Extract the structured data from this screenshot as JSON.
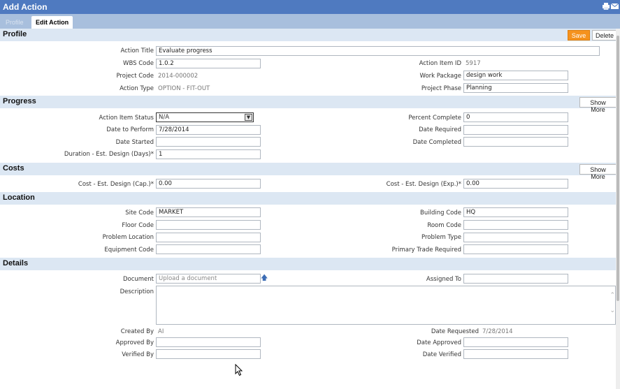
{
  "window": {
    "title": "Add Action"
  },
  "tabs": [
    {
      "label": "Profile"
    },
    {
      "label": "Edit Action"
    }
  ],
  "sections": {
    "profile": {
      "title": "Profile",
      "save": "Save",
      "delete": "Delete"
    },
    "progress": {
      "title": "Progress",
      "show_more": "Show More"
    },
    "costs": {
      "title": "Costs",
      "show_more": "Show More"
    },
    "location": {
      "title": "Location"
    },
    "details": {
      "title": "Details"
    }
  },
  "profile": {
    "action_title": {
      "label": "Action Title",
      "value": "Evaluate progress"
    },
    "wbs_code": {
      "label": "WBS Code",
      "value": "1.0.2"
    },
    "action_item_id": {
      "label": "Action Item ID",
      "value": "5917"
    },
    "project_code": {
      "label": "Project Code",
      "value": "2014-000002"
    },
    "work_package": {
      "label": "Work Package",
      "value": "design work"
    },
    "action_type": {
      "label": "Action Type",
      "value": "OPTION - FIT-OUT"
    },
    "project_phase": {
      "label": "Project Phase",
      "value": "Planning"
    }
  },
  "progress": {
    "status": {
      "label": "Action Item Status",
      "value": "N/A"
    },
    "percent_complete": {
      "label": "Percent Complete",
      "value": "0"
    },
    "date_to_perform": {
      "label": "Date to Perform",
      "value": "7/28/2014"
    },
    "date_required": {
      "label": "Date Required",
      "value": ""
    },
    "date_started": {
      "label": "Date Started",
      "value": ""
    },
    "date_completed": {
      "label": "Date Completed",
      "value": ""
    },
    "duration": {
      "label": "Duration - Est. Design (Days)*",
      "value": "1"
    }
  },
  "costs": {
    "cap": {
      "label": "Cost - Est. Design (Cap.)*",
      "value": "0.00"
    },
    "exp": {
      "label": "Cost - Est. Design (Exp.)*",
      "value": "0.00"
    }
  },
  "location": {
    "site_code": {
      "label": "Site Code",
      "value": "MARKET"
    },
    "building_code": {
      "label": "Building Code",
      "value": "HQ"
    },
    "floor_code": {
      "label": "Floor Code",
      "value": ""
    },
    "room_code": {
      "label": "Room Code",
      "value": ""
    },
    "problem_location": {
      "label": "Problem Location",
      "value": ""
    },
    "problem_type": {
      "label": "Problem Type",
      "value": ""
    },
    "equipment_code": {
      "label": "Equipment Code",
      "value": ""
    },
    "primary_trade": {
      "label": "Primary Trade Required",
      "value": ""
    }
  },
  "details": {
    "document": {
      "label": "Document",
      "placeholder": "Upload a document"
    },
    "assigned_to": {
      "label": "Assigned To",
      "value": ""
    },
    "description": {
      "label": "Description",
      "value": ""
    },
    "created_by": {
      "label": "Created By",
      "value": "AI"
    },
    "date_requested": {
      "label": "Date Requested",
      "value": "7/28/2014"
    },
    "approved_by": {
      "label": "Approved By",
      "value": ""
    },
    "date_approved": {
      "label": "Date Approved",
      "value": ""
    },
    "verified_by": {
      "label": "Verified By",
      "value": ""
    },
    "date_verified": {
      "label": "Date Verified",
      "value": ""
    }
  }
}
